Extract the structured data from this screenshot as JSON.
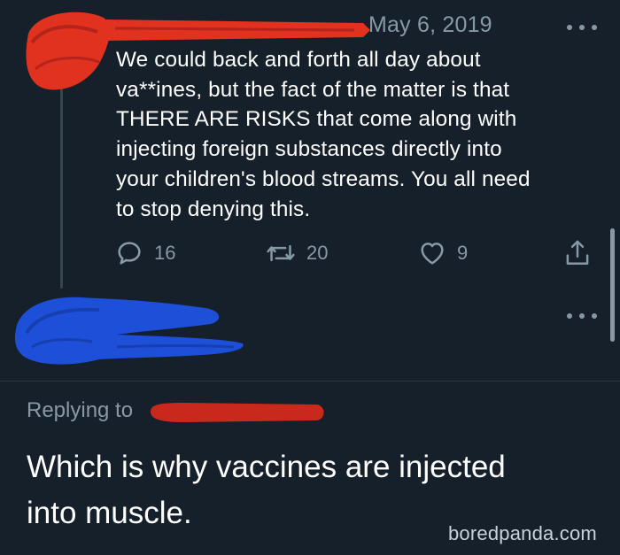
{
  "tweet1": {
    "date": "May 6, 2019",
    "text_lines": [
      "We could back and forth all day about",
      "va**ines, but the fact of the matter is that",
      "THERE ARE RISKS that come along with",
      "injecting foreign substances directly into",
      "your children's blood streams. You all need",
      "to stop denying this."
    ],
    "counts": {
      "replies": "16",
      "retweets": "20",
      "likes": "9"
    },
    "redaction_color": "#e0321e"
  },
  "tweet2": {
    "replying_to_label": "Replying to",
    "text_lines": [
      "Which is why vaccines are injected",
      "into muscle."
    ],
    "redaction_color": "#1d4fd8",
    "handle_redaction_color": "#c9281c"
  },
  "icons": {
    "more": "more-horizontal-icon",
    "reply": "reply-icon",
    "retweet": "retweet-icon",
    "like": "heart-icon",
    "share": "share-icon"
  },
  "colors": {
    "background": "#15202b",
    "secondary_text": "#8899a6"
  },
  "watermark": "boredpanda.com"
}
